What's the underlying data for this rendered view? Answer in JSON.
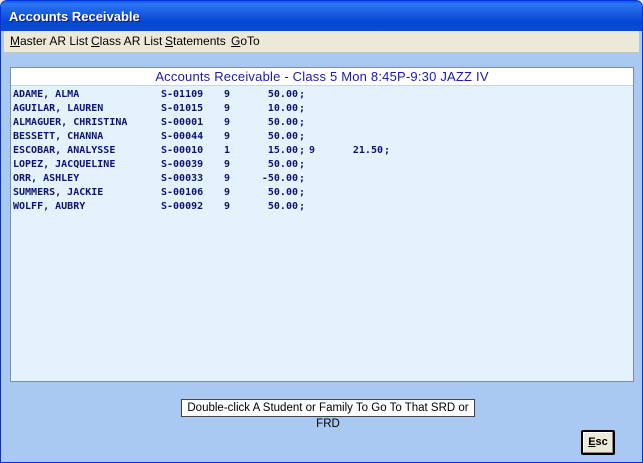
{
  "window": {
    "title": "Accounts Receivable"
  },
  "menu": [
    {
      "accel": "M",
      "rest": "aster AR List"
    },
    {
      "accel": "C",
      "rest": "lass AR List"
    },
    {
      "accel": "S",
      "rest": "tatements"
    },
    {
      "accel": "G",
      "rest": "oTo"
    }
  ],
  "panel": {
    "header": "Accounts Receivable - Class 5 Mon  8:45P-9:30   JAZZ IV"
  },
  "rows": [
    {
      "name": "ADAME, ALMA",
      "id": "S-01109",
      "count": "9",
      "amount": "50.00",
      "count2": "",
      "amount2": ""
    },
    {
      "name": "AGUILAR, LAUREN",
      "id": "S-01015",
      "count": "9",
      "amount": "10.00",
      "count2": "",
      "amount2": ""
    },
    {
      "name": "ALMAGUER, CHRISTINA",
      "id": "S-00001",
      "count": "9",
      "amount": "50.00",
      "count2": "",
      "amount2": ""
    },
    {
      "name": "BESSETT, CHANNA",
      "id": "S-00044",
      "count": "9",
      "amount": "50.00",
      "count2": "",
      "amount2": ""
    },
    {
      "name": "ESCOBAR, ANALYSSE",
      "id": "S-00010",
      "count": "1",
      "amount": "15.00",
      "count2": "9",
      "amount2": "21.50"
    },
    {
      "name": "LOPEZ, JACQUELINE",
      "id": "S-00039",
      "count": "9",
      "amount": "50.00",
      "count2": "",
      "amount2": ""
    },
    {
      "name": "ORR, ASHLEY",
      "id": "S-00033",
      "count": "9",
      "amount": "-50.00",
      "count2": "",
      "amount2": ""
    },
    {
      "name": "SUMMERS, JACKIE",
      "id": "S-00106",
      "count": "9",
      "amount": "50.00",
      "count2": "",
      "amount2": ""
    },
    {
      "name": "WOLFF, AUBRY",
      "id": "S-00092",
      "count": "9",
      "amount": "50.00",
      "count2": "",
      "amount2": ""
    }
  ],
  "hint": "Double-click A Student or Family To Go To That SRD or FRD",
  "esc": {
    "accel": "E",
    "rest": "sc"
  }
}
